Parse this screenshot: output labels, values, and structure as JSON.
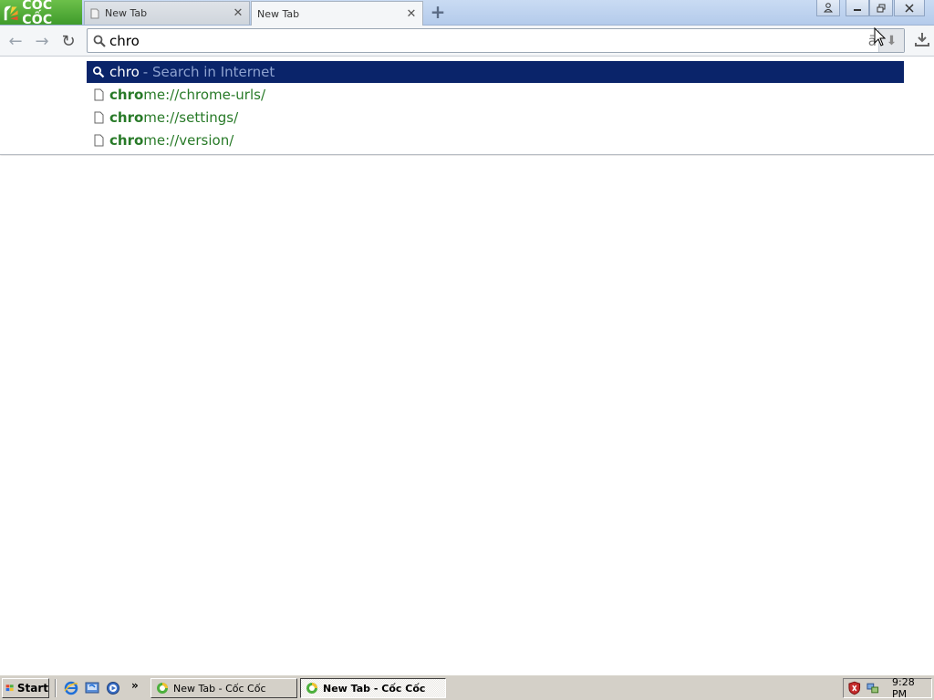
{
  "browser": {
    "brand_name": "CỐC CỐC",
    "tabs": [
      {
        "label": "New Tab",
        "active": false
      },
      {
        "label": "New Tab",
        "active": true
      }
    ],
    "new_tab_symbol": "+",
    "tab_close_symbol": "✕"
  },
  "toolbar": {
    "back_icon": "←",
    "forward_icon": "→",
    "reload_icon": "↻",
    "download_icon": "⭳"
  },
  "omnibox": {
    "value": "chro",
    "translate_icon": "ā",
    "dl_arrow": "⬇"
  },
  "suggestions": [
    {
      "kind": "search",
      "query": "chro",
      "hint": "- Search in Internet",
      "selected": true
    },
    {
      "kind": "url",
      "match": "chro",
      "rest": "me://chrome-urls/",
      "selected": false
    },
    {
      "kind": "url",
      "match": "chro",
      "rest": "me://settings/",
      "selected": false
    },
    {
      "kind": "url",
      "match": "chro",
      "rest": "me://version/",
      "selected": false
    }
  ],
  "taskbar": {
    "start_label": "Start",
    "more_symbol": "»",
    "tasks": [
      {
        "label": "New Tab - Cốc Cốc",
        "pressed": false
      },
      {
        "label": "New Tab - Cốc Cốc",
        "pressed": true
      }
    ],
    "clock": "9:28 PM"
  },
  "colors": {
    "brand_green": "#3f9b2b",
    "selection_blue": "#0a246a",
    "match_green": "#287a28"
  }
}
